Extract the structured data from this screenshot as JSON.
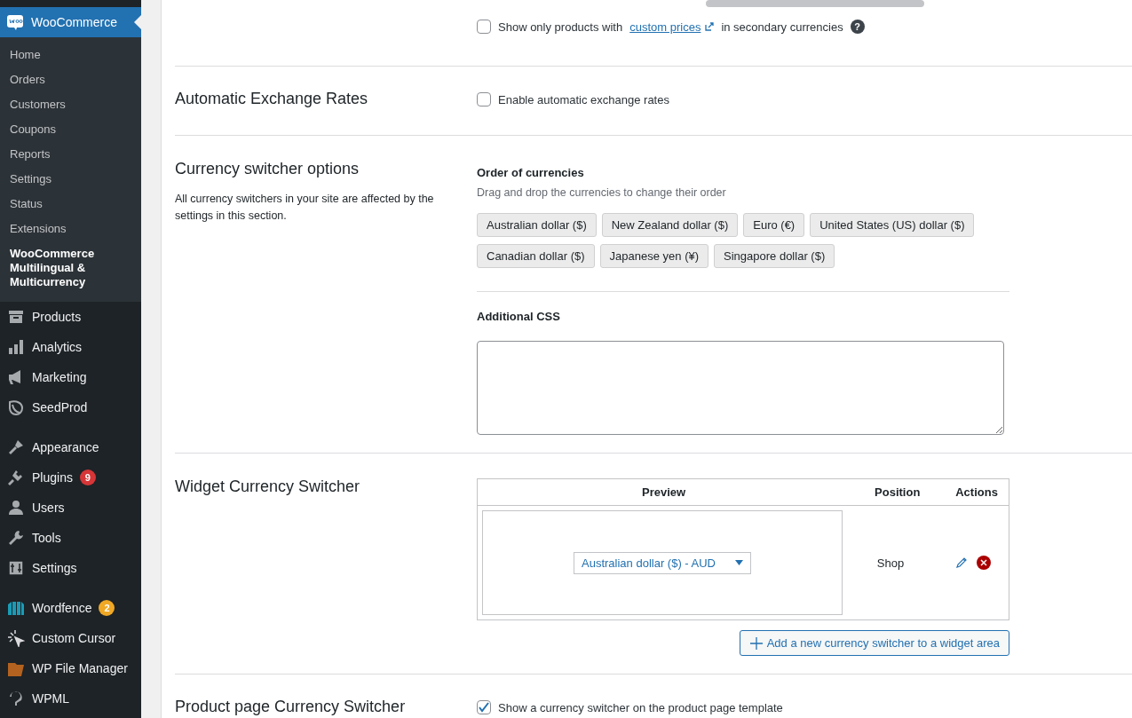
{
  "sidebar": {
    "active_menu": {
      "label": "WooCommerce",
      "submenu": [
        {
          "label": "Home",
          "selected": false
        },
        {
          "label": "Orders",
          "selected": false
        },
        {
          "label": "Customers",
          "selected": false
        },
        {
          "label": "Coupons",
          "selected": false
        },
        {
          "label": "Reports",
          "selected": false
        },
        {
          "label": "Settings",
          "selected": false
        },
        {
          "label": "Status",
          "selected": false
        },
        {
          "label": "Extensions",
          "selected": false
        },
        {
          "label": "WooCommerce Multilingual & Multicurrency",
          "selected": true
        }
      ]
    },
    "items": [
      {
        "label": "Products",
        "gap_before": false
      },
      {
        "label": "Analytics",
        "gap_before": false
      },
      {
        "label": "Marketing",
        "gap_before": false
      },
      {
        "label": "SeedProd",
        "gap_before": false
      },
      {
        "label": "Appearance",
        "gap_before": true
      },
      {
        "label": "Plugins",
        "gap_before": false,
        "badge": "9",
        "color": "#d63638"
      },
      {
        "label": "Users",
        "gap_before": false
      },
      {
        "label": "Tools",
        "gap_before": false
      },
      {
        "label": "Settings",
        "gap_before": false
      },
      {
        "label": "Wordfence",
        "gap_before": true,
        "badge": "2",
        "color": "#f0a825"
      },
      {
        "label": "Custom Cursor",
        "gap_before": false
      },
      {
        "label": "WP File Manager",
        "gap_before": false
      },
      {
        "label": "WPML",
        "gap_before": false
      }
    ]
  },
  "sections": [
    {
      "kind": "checkbox",
      "checked": false,
      "text_before": "Show only products with",
      "link": "custom prices",
      "text_after": "in secondary currencies",
      "help": "?"
    },
    {
      "kind": "setting",
      "title": "Automatic Exchange Rates",
      "checkbox": {
        "label": "Enable automatic exchange rates",
        "checked": false
      }
    },
    {
      "kind": "switcher_options",
      "title": "Currency switcher options",
      "description": "All currency switchers in your site are affected by the settings in this section.",
      "order_label": "Order of currencies",
      "order_hint": "Drag and drop the currencies to change their order",
      "currencies": [
        "Australian dollar ($)",
        "New Zealand dollar ($)",
        "Euro (€)",
        "United States (US) dollar ($)",
        "Canadian dollar ($)",
        "Japanese yen (¥)",
        "Singapore dollar ($)"
      ],
      "css_label": "Additional CSS"
    },
    {
      "kind": "widget",
      "title": "Widget Currency Switcher",
      "columns": [
        "Preview",
        "Position",
        "Actions"
      ],
      "rows": [
        {
          "preview": "Australian dollar ($) - AUD",
          "position": "Shop"
        }
      ],
      "add_button": "Add a new currency switcher to a widget area"
    },
    {
      "kind": "setting",
      "title": "Product page Currency Switcher",
      "checkbox": {
        "label": "Show a currency switcher on the product page template",
        "checked": true
      }
    }
  ]
}
